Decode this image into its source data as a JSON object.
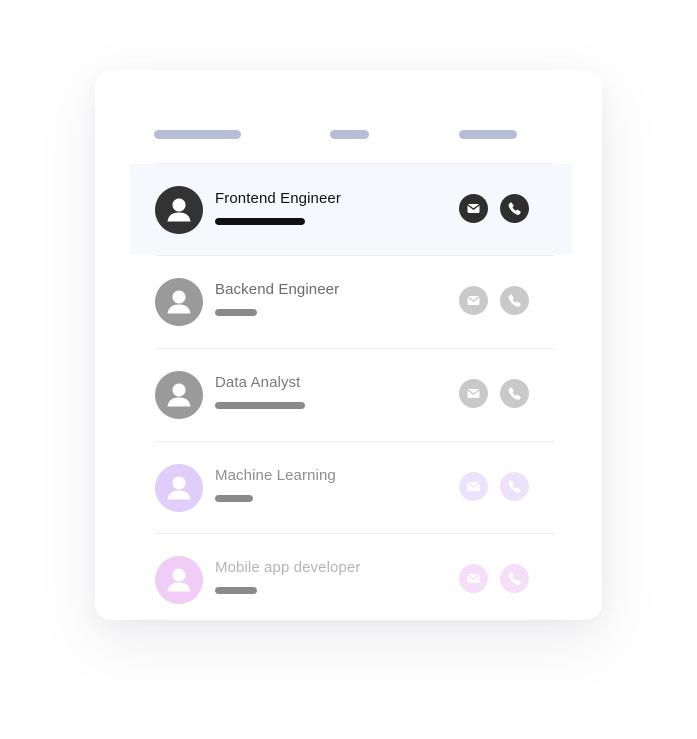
{
  "header": {
    "columns": [
      "",
      "",
      ""
    ]
  },
  "rows": [
    {
      "role": "Frontend Engineer",
      "text_color": "#111111",
      "avatar_color": "#333333",
      "bar_color": "#111111",
      "icon_bg": "#2f2f2f",
      "selected": true,
      "icons": [
        "mail-icon",
        "phone-icon"
      ]
    },
    {
      "role": "Backend Engineer",
      "text_color": "#6b6b6b",
      "avatar_color": "#9a9a9a",
      "bar_color": "#8a8a8a",
      "icon_bg": "#c9c9c9",
      "selected": false,
      "icons": [
        "mail-icon",
        "phone-icon"
      ]
    },
    {
      "role": "Data Analyst",
      "text_color": "#7a7a7a",
      "avatar_color": "#9a9a9a",
      "bar_color": "#8a8a8a",
      "icon_bg": "#c9c9c9",
      "selected": false,
      "icons": [
        "mail-icon",
        "phone-icon"
      ]
    },
    {
      "role": "Machine Learning",
      "text_color": "#8e8e8e",
      "avatar_color": "#e0cdfa",
      "bar_color": "#8a8a8a",
      "icon_bg": "#ede2fc",
      "selected": false,
      "icons": [
        "mail-icon",
        "phone-icon"
      ]
    },
    {
      "role": "Mobile app developer",
      "text_color": "#b5b5b5",
      "avatar_color": "#efcdf6",
      "bar_color": "#8a8a8a",
      "icon_bg": "#f5dff8",
      "selected": false,
      "icons": [
        "mail-icon",
        "phone-icon"
      ]
    }
  ]
}
